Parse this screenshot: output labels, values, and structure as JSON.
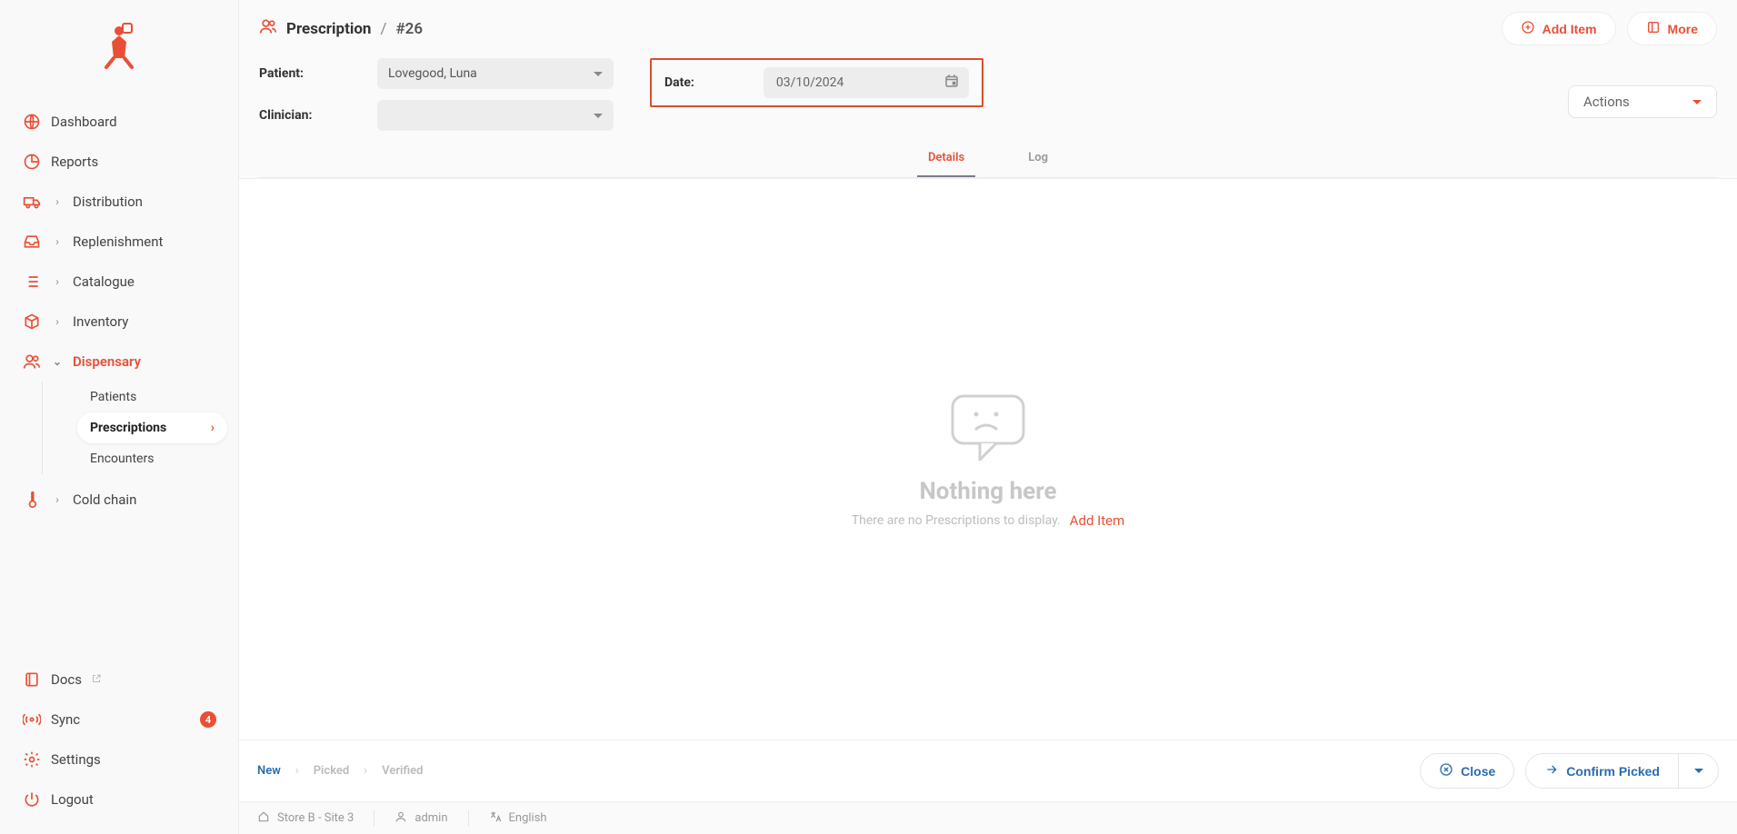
{
  "sidebar": {
    "items": {
      "dashboard": "Dashboard",
      "reports": "Reports",
      "distribution": "Distribution",
      "replenishment": "Replenishment",
      "catalogue": "Catalogue",
      "inventory": "Inventory",
      "dispensary": "Dispensary",
      "coldchain": "Cold chain",
      "docs": "Docs",
      "sync": "Sync",
      "settings": "Settings",
      "logout": "Logout"
    },
    "sub": {
      "patients": "Patients",
      "prescriptions": "Prescriptions",
      "encounters": "Encounters"
    },
    "syncBadge": "4"
  },
  "header": {
    "title": "Prescription",
    "slash": "/",
    "id": "#26",
    "addItem": "Add Item",
    "more": "More"
  },
  "form": {
    "patientLabel": "Patient:",
    "patientValue": "Lovegood, Luna",
    "clinicianLabel": "Clinician:",
    "clinicianValue": "",
    "dateLabel": "Date:",
    "dateValue": "03/10/2024",
    "actionsLabel": "Actions"
  },
  "tabs": {
    "details": "Details",
    "log": "Log"
  },
  "empty": {
    "title": "Nothing here",
    "subtitle": "There are no Prescriptions to display.",
    "addItem": "Add Item"
  },
  "status": {
    "new": "New",
    "picked": "Picked",
    "verified": "Verified",
    "close": "Close",
    "confirm": "Confirm Picked"
  },
  "footer": {
    "store": "Store B - Site 3",
    "user": "admin",
    "lang": "English"
  }
}
